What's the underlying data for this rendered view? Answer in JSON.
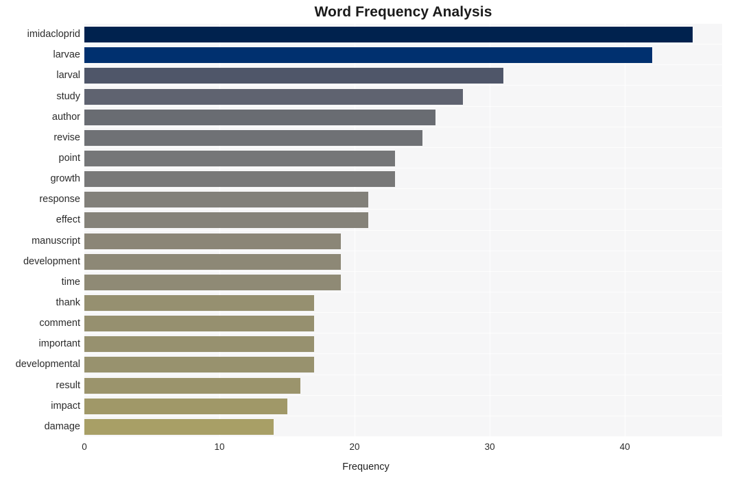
{
  "chart_data": {
    "type": "bar",
    "orientation": "horizontal",
    "title": "Word Frequency Analysis",
    "xlabel": "Frequency",
    "ylabel": "",
    "categories": [
      "imidacloprid",
      "larvae",
      "larval",
      "study",
      "author",
      "revise",
      "point",
      "growth",
      "response",
      "effect",
      "manuscript",
      "development",
      "time",
      "thank",
      "comment",
      "important",
      "developmental",
      "result",
      "impact",
      "damage"
    ],
    "values": [
      45,
      42,
      31,
      28,
      26,
      25,
      23,
      23,
      21,
      21,
      19,
      19,
      19,
      17,
      17,
      17,
      17,
      16,
      15,
      14
    ],
    "bar_colors": [
      "#00224e",
      "#00306f",
      "#4f5669",
      "#5f6370",
      "#696c72",
      "#6f7175",
      "#757678",
      "#787878",
      "#82807a",
      "#858279",
      "#8b8677",
      "#8d8876",
      "#8f8a75",
      "#969070",
      "#96906f",
      "#97916f",
      "#98926e",
      "#9b946c",
      "#a09868",
      "#a89f66"
    ],
    "xlim": [
      0,
      47.2
    ],
    "xticks": [
      0,
      10,
      20,
      30,
      40
    ],
    "xtick_labels": [
      "0",
      "10",
      "20",
      "30",
      "40"
    ],
    "grid": true,
    "grid_color": "#ffffff",
    "plot_background": "#f6f6f7",
    "figure_background": "#ffffff",
    "legend": null
  }
}
